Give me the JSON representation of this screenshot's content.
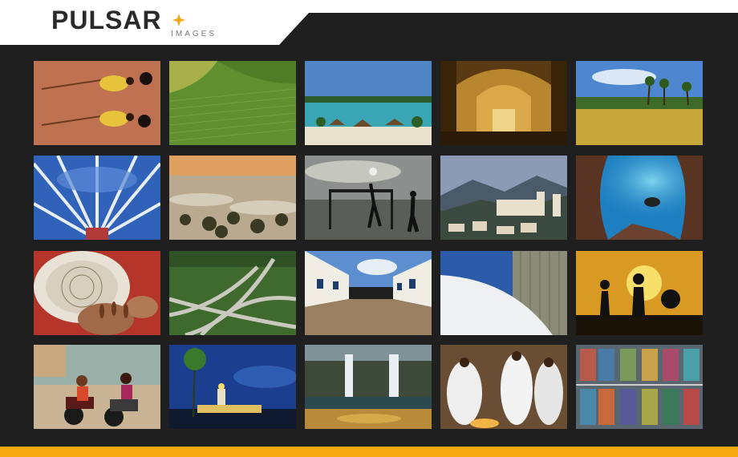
{
  "brand": {
    "wordmark": "PULSAR",
    "subtitle": "IMAGES",
    "accent_color": "#f5a90f"
  },
  "gallery": {
    "thumbnails": [
      "aerial-people-with-bows",
      "green-crop-field",
      "beach-huts-lagoon",
      "baroque-church-interior",
      "palm-savanna",
      "cathedral-stained-glass-ceiling",
      "misty-forest-sunrise",
      "beach-soccer-goal",
      "colonial-town-mountains",
      "diver-in-cave",
      "lace-making-bobbins",
      "highway-interchange",
      "colonial-cobblestone-street",
      "modern-building-curve",
      "children-silhouette-sunset",
      "motorcycle-riders",
      "lighthouse-at-night",
      "waterfall-canyon",
      "ceremony-white-dress",
      "container-port-aerial"
    ]
  }
}
